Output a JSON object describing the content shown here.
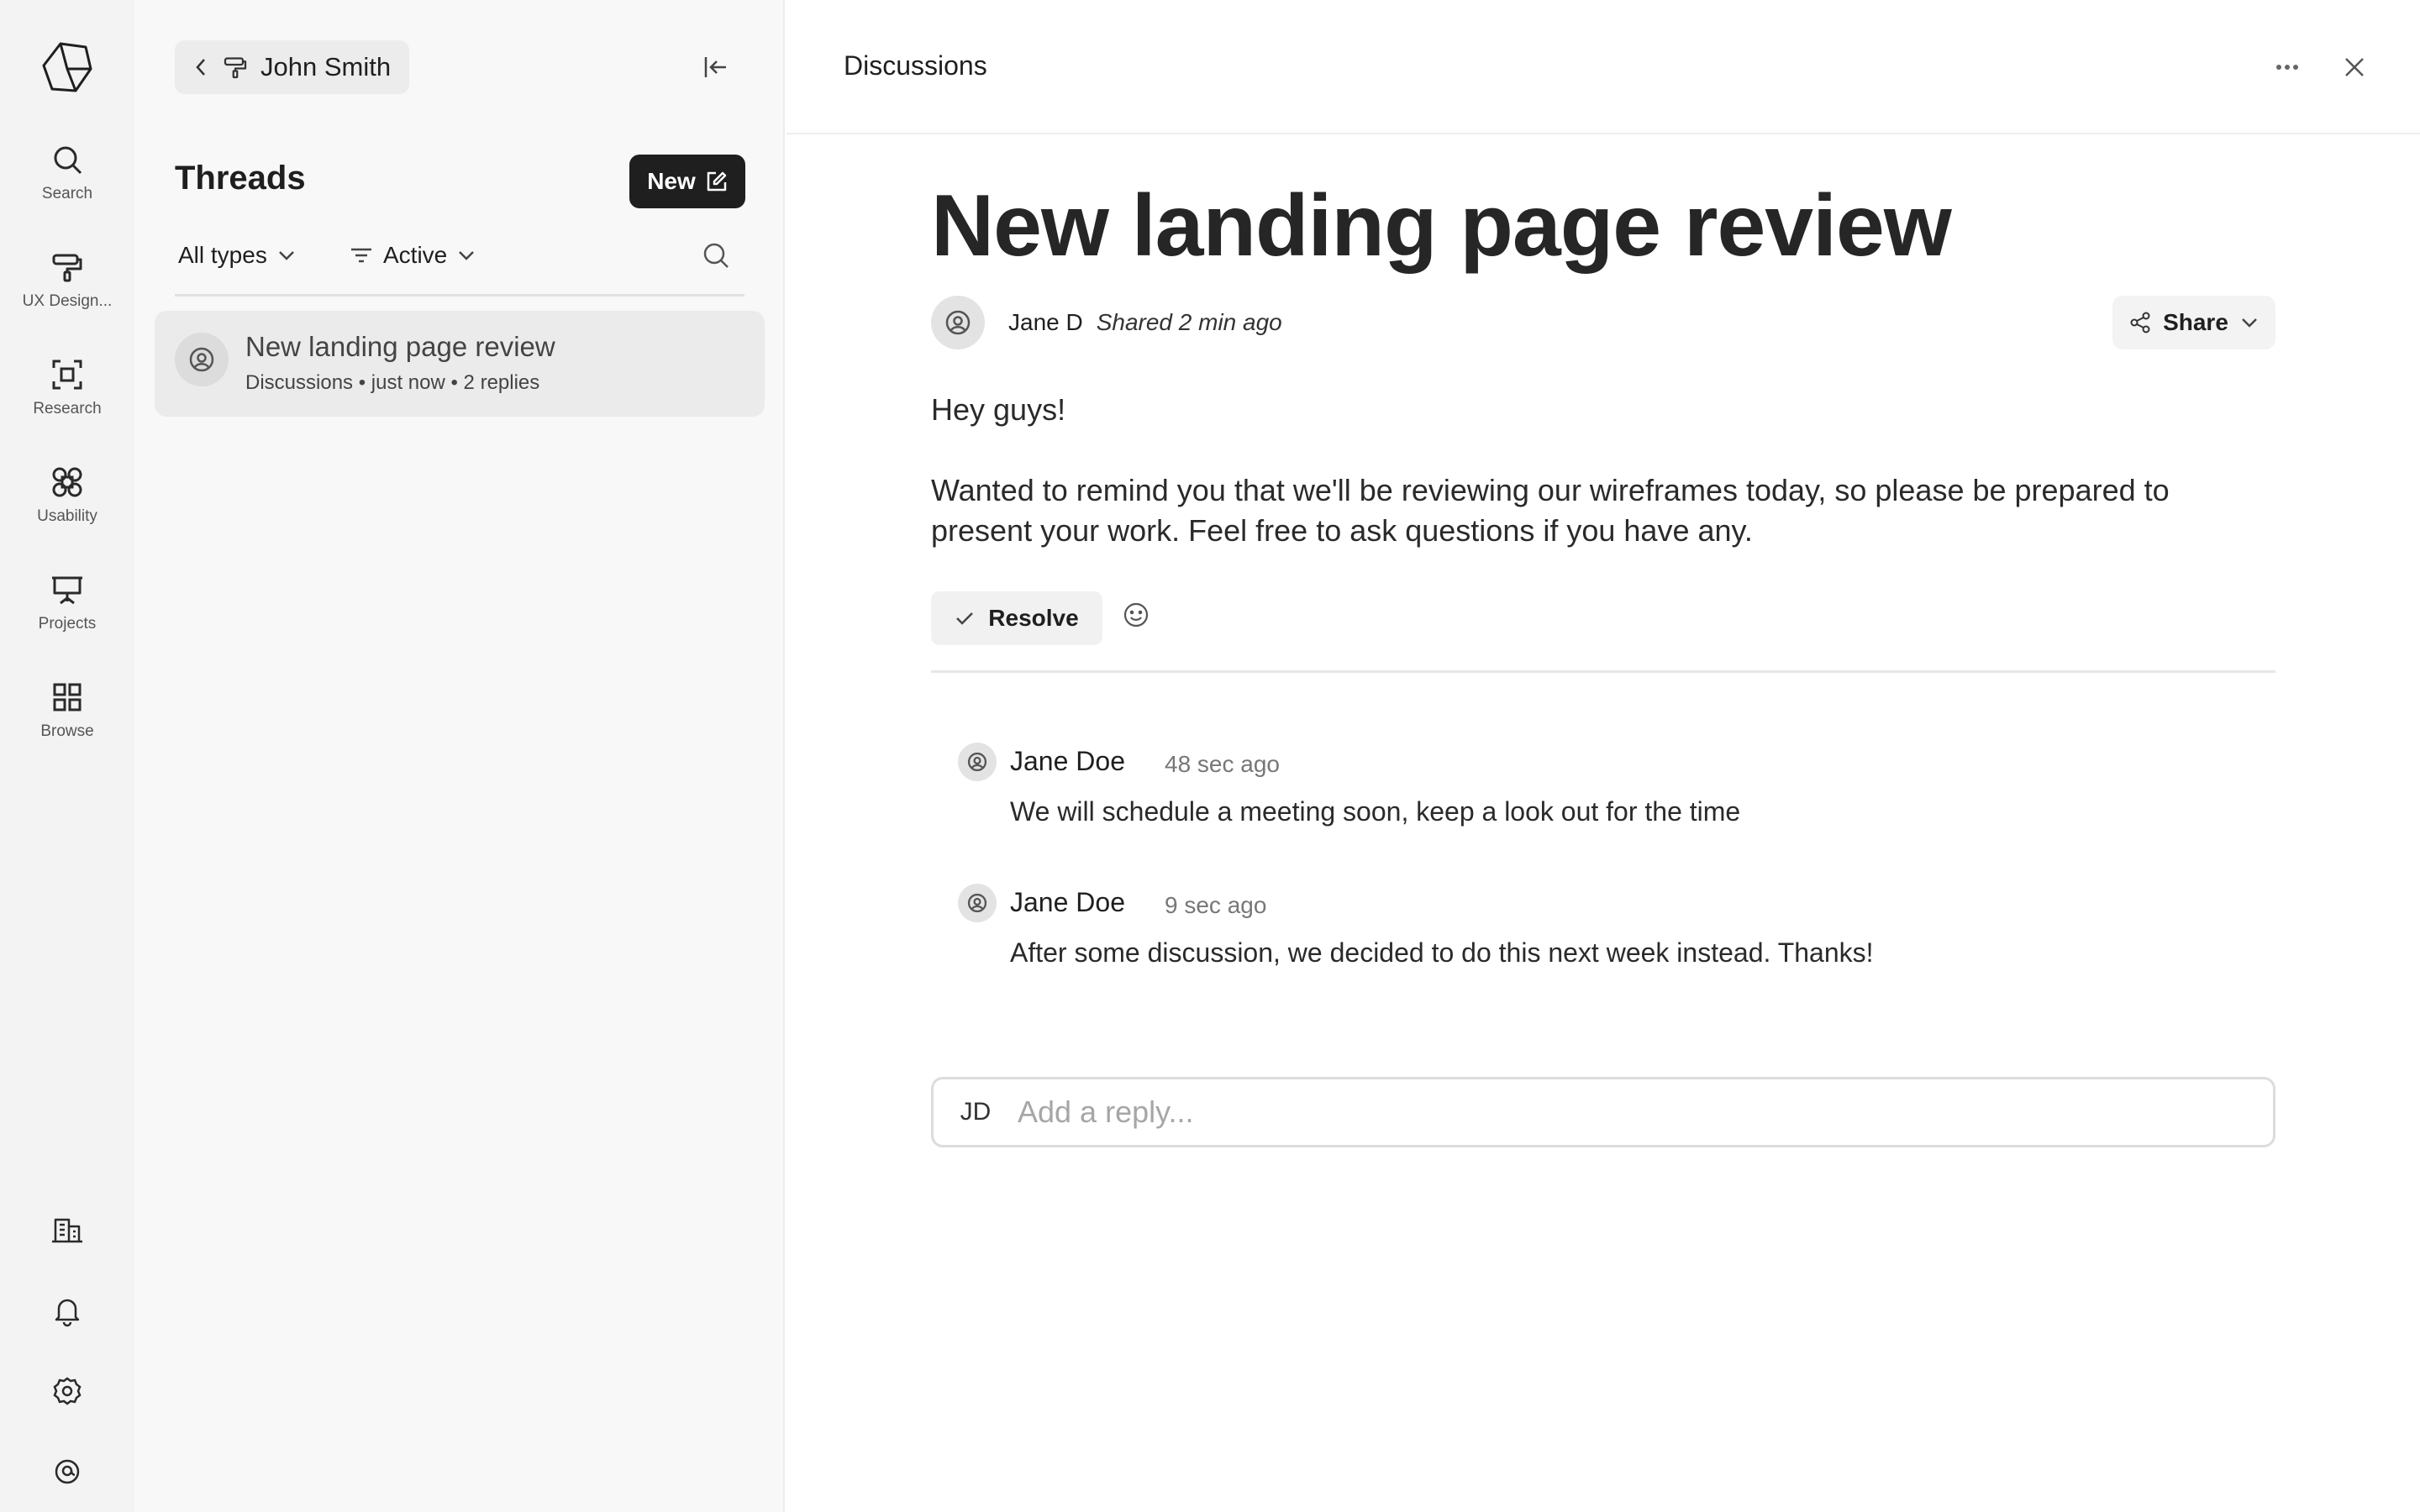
{
  "rail": {
    "items": [
      {
        "label": "Search",
        "icon": "search-icon"
      },
      {
        "label": "UX Design...",
        "icon": "paint-roller-icon"
      },
      {
        "label": "Research",
        "icon": "focus-frame-icon"
      },
      {
        "label": "Usability",
        "icon": "command-icon"
      },
      {
        "label": "Projects",
        "icon": "presentation-board-icon"
      },
      {
        "label": "Browse",
        "icon": "grid-icon"
      }
    ],
    "bottom_icons": [
      "building-icon",
      "bell-icon",
      "gear-icon",
      "user-avatar-icon"
    ]
  },
  "threads_panel": {
    "breadcrumb_name": "John Smith",
    "title": "Threads",
    "new_button_label": "New",
    "filter_type": "All types",
    "filter_status": "Active",
    "threads": [
      {
        "title": "New landing page review",
        "meta": "Discussions • just now • 2 replies"
      }
    ]
  },
  "main": {
    "header_title": "Discussions",
    "post": {
      "title": "New landing page review",
      "author": "Jane D",
      "shared": "Shared 2 min ago",
      "share_label": "Share",
      "paragraphs": [
        "Hey guys!",
        "Wanted to remind you that we'll be reviewing our wireframes today, so please be prepared to present your work. Feel free to ask questions if you have any."
      ],
      "resolve_label": "Resolve"
    },
    "replies": [
      {
        "author": "Jane Doe",
        "time": "48 sec ago",
        "message": "We will schedule a meeting soon, keep a look out for the time"
      },
      {
        "author": "Jane Doe",
        "time": "9 sec ago",
        "message": "After some discussion, we decided to do this next week instead. Thanks!"
      }
    ],
    "reply_box": {
      "initials": "JD",
      "placeholder": "Add a reply..."
    }
  }
}
